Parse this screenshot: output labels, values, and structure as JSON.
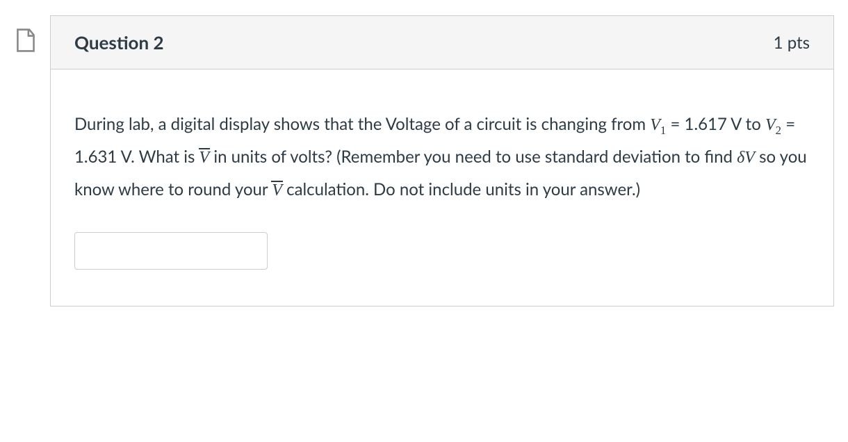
{
  "question": {
    "title": "Question 2",
    "points": "1 pts",
    "text_pre": "During lab, a digital display shows that the Voltage of a circuit is changing from ",
    "v1_label": "V",
    "v1_sub": "1",
    "v1_val": " = 1.617 V to ",
    "v2_label": "V",
    "v2_sub": "2",
    "v2_val": " = 1.631 V.  What is ",
    "vbar1": "V",
    "text_mid": " in units of volts?  (Remember you need to use standard deviation to find ",
    "delta_v": "δV",
    "text_after_delta": " so you know where to round your ",
    "vbar2": "V",
    "text_end": " calculation. Do not include units in your answer.)",
    "answer_value": ""
  }
}
